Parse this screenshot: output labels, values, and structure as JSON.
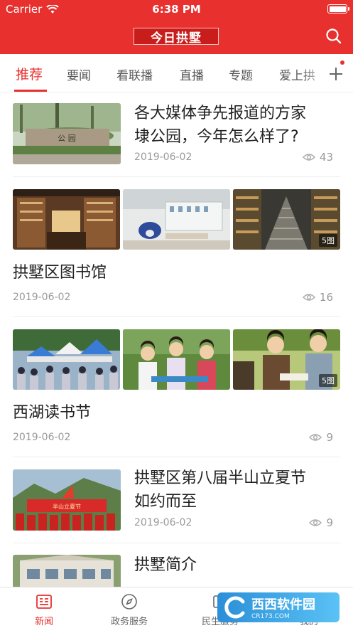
{
  "status": {
    "carrier": "Carrier",
    "time": "6:38 PM"
  },
  "header": {
    "logo_text": "今日拱墅",
    "search_icon": "search-icon"
  },
  "tabs": [
    {
      "label": "推荐",
      "active": true
    },
    {
      "label": "要闻"
    },
    {
      "label": "看联播"
    },
    {
      "label": "直播"
    },
    {
      "label": "专题"
    },
    {
      "label": "爱上拱"
    }
  ],
  "add_tab_icon": "plus-icon",
  "feed": [
    {
      "title_line1": "各大媒体争先报道的方家",
      "title_line2": "埭公园，今年怎么样了?",
      "date": "2019-06-02",
      "views": "43"
    },
    {
      "title": "拱墅区图书馆",
      "date": "2019-06-02",
      "views": "16",
      "badge": "5图"
    },
    {
      "title": "西湖读书节",
      "date": "2019-06-02",
      "views": "9",
      "badge": "5图"
    },
    {
      "title_line1": "拱墅区第八届半山立夏节",
      "title_line2": "如约而至",
      "date": "2019-06-02",
      "views": "9"
    },
    {
      "title": "拱墅简介"
    }
  ],
  "bottom_nav": [
    {
      "label": "新闻",
      "icon": "news-icon",
      "active": true
    },
    {
      "label": "政务服务",
      "icon": "compass-icon"
    },
    {
      "label": "民生服务",
      "icon": "service-icon"
    },
    {
      "label": "我的",
      "icon": "profile-icon"
    }
  ],
  "watermark": {
    "name": "西西软件园",
    "url": "CR173.COM"
  },
  "colors": {
    "brand_red": "#e8312f",
    "text_gray": "#999999"
  }
}
